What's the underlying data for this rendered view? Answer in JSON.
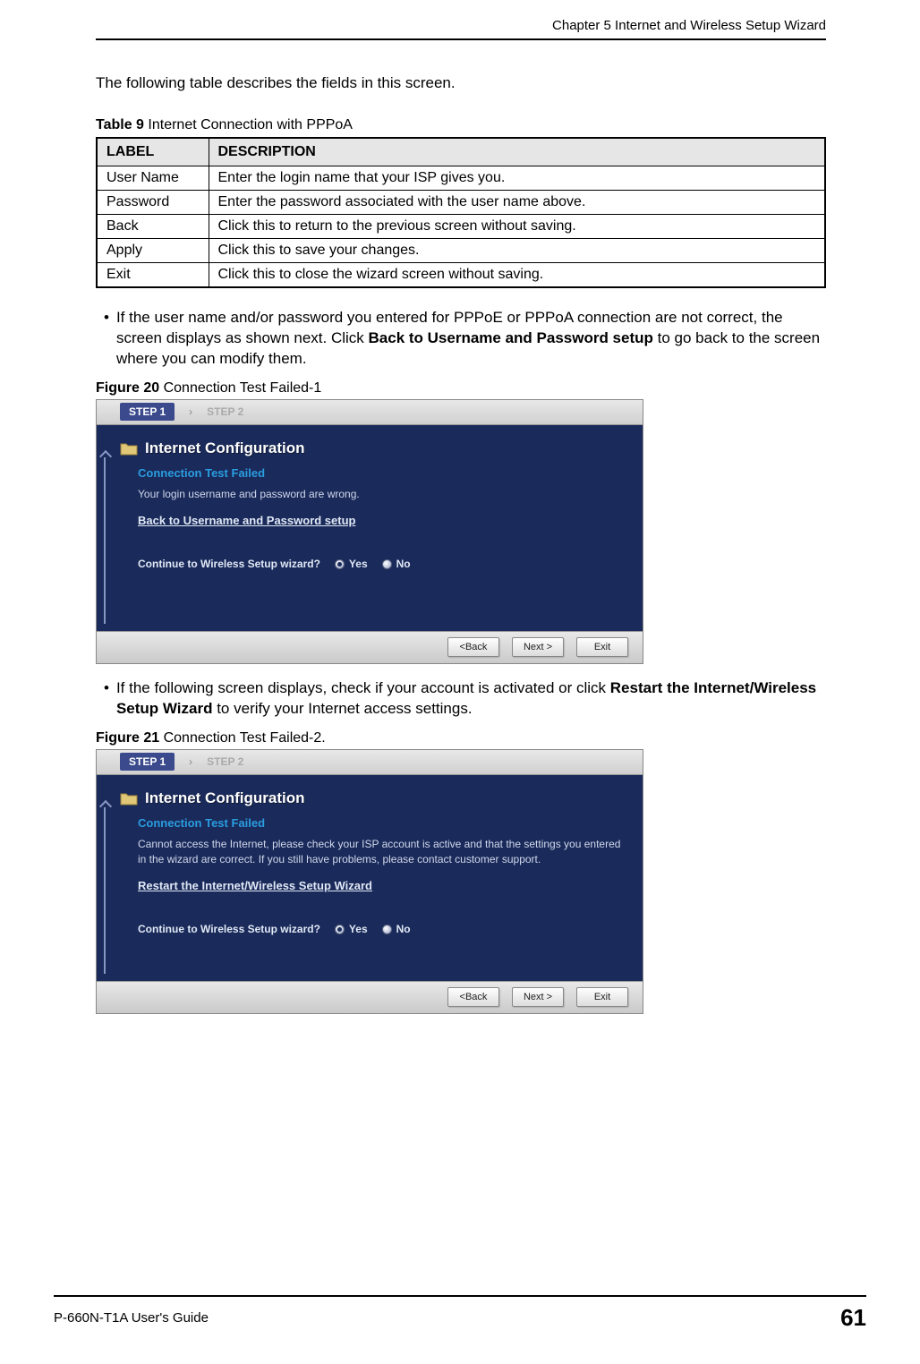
{
  "header": {
    "chapter": "Chapter 5 Internet and Wireless Setup Wizard"
  },
  "intro": "The following table describes the fields in this screen.",
  "table": {
    "caption_bold": "Table 9",
    "caption_rest": "   Internet Connection with PPPoA",
    "head_label": "LABEL",
    "head_desc": "DESCRIPTION",
    "rows": [
      {
        "label": "User Name",
        "desc": "Enter the login name that your ISP gives you."
      },
      {
        "label": "Password",
        "desc": "Enter the password associated with the user name above."
      },
      {
        "label": "Back",
        "desc": "Click this to return to the previous screen without saving."
      },
      {
        "label": "Apply",
        "desc": "Click this to save your changes."
      },
      {
        "label": "Exit",
        "desc": "Click this to close the wizard screen without saving."
      }
    ]
  },
  "bullet1": {
    "pre": "If the user name and/or password you entered for PPPoE or PPPoA connection are not correct, the screen displays as shown next. Click ",
    "bold": "Back to Username and Password setup",
    "post": " to go back to the screen where you can modify them."
  },
  "figure20": {
    "caption_bold": "Figure 20",
    "caption_rest": "   Connection Test Failed-1",
    "step_active": "STEP 1",
    "step_inactive": "STEP 2",
    "title": "Internet Configuration",
    "subtitle": "Connection Test Failed",
    "message": "Your login username and password are wrong.",
    "link": "Back to Username and Password setup",
    "continue_q": "Continue to Wireless Setup wizard?",
    "opt_yes": "Yes",
    "opt_no": "No",
    "btn_back": "<Back",
    "btn_next": "Next >",
    "btn_exit": "Exit"
  },
  "bullet2": {
    "pre": "If the following screen displays, check if your account is activated or click ",
    "bold": "Restart the Internet/Wireless Setup Wizard",
    "post": " to verify your Internet access settings."
  },
  "figure21": {
    "caption_bold": "Figure 21",
    "caption_rest": "   Connection Test Failed-2.",
    "step_active": "STEP 1",
    "step_inactive": "STEP 2",
    "title": "Internet Configuration",
    "subtitle": "Connection Test Failed",
    "message": "Cannot access the Internet, please check your ISP account is active and that the settings you entered in the wizard are correct. If you still have problems, please contact customer support.",
    "link": "Restart the Internet/Wireless Setup Wizard",
    "continue_q": "Continue to Wireless Setup wizard?",
    "opt_yes": "Yes",
    "opt_no": "No",
    "btn_back": "<Back",
    "btn_next": "Next >",
    "btn_exit": "Exit"
  },
  "footer": {
    "guide": "P-660N-T1A User's Guide",
    "page": "61"
  }
}
